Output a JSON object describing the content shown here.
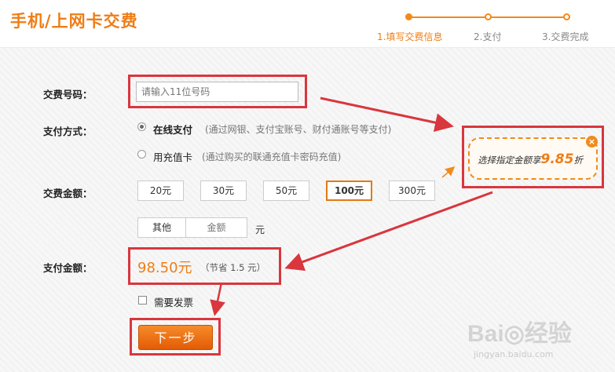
{
  "header": {
    "title": "手机/上网卡交费",
    "steps": [
      {
        "label": "1.填写交费信息",
        "active": true
      },
      {
        "label": "2.支付",
        "active": false
      },
      {
        "label": "3.交费完成",
        "active": false
      }
    ]
  },
  "form": {
    "number_label": "交费号码：",
    "number_placeholder": "请输入11位号码",
    "number_value": "",
    "pay_method_label": "支付方式：",
    "methods": [
      {
        "title": "在线支付",
        "desc": "(通过网银、支付宝账号、财付通账号等支付)",
        "selected": true
      },
      {
        "title": "用充值卡",
        "desc": "(通过购买的联通充值卡密码充值)",
        "selected": false
      }
    ],
    "amount_label": "交费金额：",
    "amounts": [
      "20元",
      "30元",
      "50元",
      "100元",
      "300元"
    ],
    "selected_amount": "100元",
    "other_label": "其他",
    "other_placeholder": "金额",
    "other_unit": "元",
    "pay_amount_label": "支付金额：",
    "pay_amount": "98.50元",
    "pay_note": "（节省 1.5 元）",
    "invoice_label": "需要发票",
    "invoice_checked": false,
    "next_button": "下一步"
  },
  "promo": {
    "text": "选择指定金额享",
    "discount": "9.85",
    "suffix": "折",
    "close_icon": "close-icon"
  },
  "watermark": {
    "text": "Bai◎经验",
    "sub": "jingyan.baidu.com"
  },
  "colors": {
    "accent": "#ef7d16",
    "annotation_red": "#d9363e"
  }
}
